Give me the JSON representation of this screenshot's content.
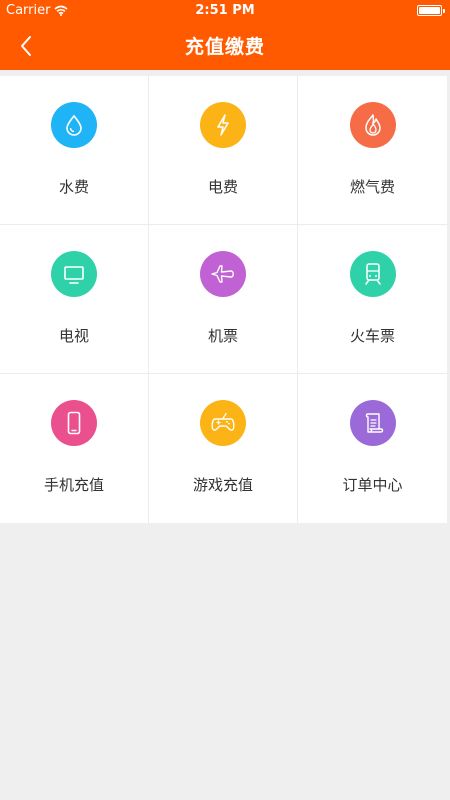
{
  "status_bar": {
    "carrier": "Carrier",
    "time": "2:51 PM",
    "battery_level": 1.0
  },
  "nav": {
    "title": "充值缴费",
    "back_icon": "chevron-left-icon"
  },
  "services": [
    {
      "label": "水费",
      "icon": "water-drop-icon",
      "color": "#1eb4f5"
    },
    {
      "label": "电费",
      "icon": "lightning-icon",
      "color": "#fbb315"
    },
    {
      "label": "燃气费",
      "icon": "flame-icon",
      "color": "#f56c47"
    },
    {
      "label": "电视",
      "icon": "tv-icon",
      "color": "#2fd1a9"
    },
    {
      "label": "机票",
      "icon": "airplane-icon",
      "color": "#c162d4"
    },
    {
      "label": "火车票",
      "icon": "train-icon",
      "color": "#2fd1a9"
    },
    {
      "label": "手机充值",
      "icon": "mobile-phone-icon",
      "color": "#ea4f8e"
    },
    {
      "label": "游戏充值",
      "icon": "gamepad-icon",
      "color": "#fbb315"
    },
    {
      "label": "订单中心",
      "icon": "scroll-icon",
      "color": "#9b6ad8"
    }
  ],
  "colors": {
    "header": "#ff5a00",
    "background": "#efefef"
  }
}
